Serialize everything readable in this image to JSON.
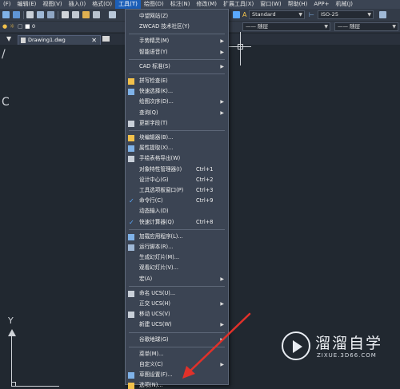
{
  "menubar": {
    "items": [
      "(F)",
      "编辑(E)",
      "视图(V)",
      "插入(I)",
      "格式(O)",
      "工具(T)",
      "绘图(D)",
      "标注(N)",
      "修改(M)",
      "扩展工具(X)",
      "窗口(W)",
      "帮助(H)",
      "APP+",
      "机械(J)"
    ],
    "active_index": 5
  },
  "toolbar": {
    "text_style": "Standard",
    "dim_style": "ISO-25",
    "layer_left": "0",
    "linetype": "—— 随层",
    "lineweight": "—— 随层"
  },
  "doc_tab": {
    "filename": "Drawing1.dwg",
    "close": "✕"
  },
  "canvas": {
    "ucs_y": "Y",
    "ucs_x": "X",
    "ghost_left": "/",
    "ghost_left2": "C"
  },
  "tools_menu": {
    "items": [
      {
        "label": "中望网站(Z)",
        "shortcut": "",
        "submenu": false,
        "icon": "",
        "checked": false
      },
      {
        "label": "ZWCAD 技术社区(Y)",
        "shortcut": "",
        "submenu": false,
        "icon": "",
        "checked": false
      },
      {
        "sep": true
      },
      {
        "label": "手势精灵(M)",
        "shortcut": "",
        "submenu": true,
        "icon": "",
        "checked": false
      },
      {
        "label": "智能语音(Y)",
        "shortcut": "",
        "submenu": true,
        "icon": "",
        "checked": false
      },
      {
        "sep": true
      },
      {
        "label": "CAD 标准(S)",
        "shortcut": "",
        "submenu": true,
        "icon": "",
        "checked": false
      },
      {
        "sep": true
      },
      {
        "label": "拼写检查(E)",
        "shortcut": "",
        "submenu": false,
        "icon": "spell-check-icon",
        "checked": false
      },
      {
        "label": "快速选择(K)...",
        "shortcut": "",
        "submenu": false,
        "icon": "quick-select-icon",
        "checked": false
      },
      {
        "label": "绘图次序(D)...",
        "shortcut": "",
        "submenu": true,
        "icon": "",
        "checked": false
      },
      {
        "label": "查询(Q)",
        "shortcut": "",
        "submenu": true,
        "icon": "",
        "checked": false
      },
      {
        "label": "更新字段(T)",
        "shortcut": "",
        "submenu": false,
        "icon": "update-field-icon",
        "checked": false
      },
      {
        "sep": true
      },
      {
        "label": "块编辑器(B)...",
        "shortcut": "",
        "submenu": false,
        "icon": "block-editor-icon",
        "checked": false
      },
      {
        "label": "属性提取(X)...",
        "shortcut": "",
        "submenu": false,
        "icon": "attribute-extract-icon",
        "checked": false
      },
      {
        "label": "手绘表格导出(W)",
        "shortcut": "",
        "submenu": false,
        "icon": "table-export-icon",
        "checked": false
      },
      {
        "label": "对象特性管理器(I)",
        "shortcut": "Ctrl+1",
        "submenu": false,
        "icon": "",
        "checked": false
      },
      {
        "label": "设计中心(G)",
        "shortcut": "Ctrl+2",
        "submenu": false,
        "icon": "",
        "checked": false
      },
      {
        "label": "工具选项板窗口(P)",
        "shortcut": "Ctrl+3",
        "submenu": false,
        "icon": "",
        "checked": false
      },
      {
        "label": "命令行(C)",
        "shortcut": "Ctrl+9",
        "submenu": false,
        "icon": "",
        "checked": true
      },
      {
        "label": "动态输入(D)",
        "shortcut": "",
        "submenu": false,
        "icon": "",
        "checked": false
      },
      {
        "label": "快速计算器(Q)",
        "shortcut": "Ctrl+8",
        "submenu": false,
        "icon": "",
        "checked": true
      },
      {
        "sep": true
      },
      {
        "label": "加载应用程序(L)...",
        "shortcut": "",
        "submenu": false,
        "icon": "load-app-icon",
        "checked": false
      },
      {
        "label": "运行脚本(R)...",
        "shortcut": "",
        "submenu": false,
        "icon": "run-script-icon",
        "checked": false
      },
      {
        "label": "生成幻灯片(M)...",
        "shortcut": "",
        "submenu": false,
        "icon": "",
        "checked": false
      },
      {
        "label": "观看幻灯片(V)...",
        "shortcut": "",
        "submenu": false,
        "icon": "",
        "checked": false
      },
      {
        "label": "宏(A)",
        "shortcut": "",
        "submenu": true,
        "icon": "",
        "checked": false
      },
      {
        "sep": true
      },
      {
        "label": "命名 UCS(U)...",
        "shortcut": "",
        "submenu": false,
        "icon": "named-ucs-icon",
        "checked": false
      },
      {
        "label": "正交 UCS(H)",
        "shortcut": "",
        "submenu": true,
        "icon": "",
        "checked": false
      },
      {
        "label": "移动 UCS(V)",
        "shortcut": "",
        "submenu": false,
        "icon": "move-ucs-icon",
        "checked": false
      },
      {
        "label": "新建 UCS(W)",
        "shortcut": "",
        "submenu": true,
        "icon": "",
        "checked": false
      },
      {
        "sep": true
      },
      {
        "label": "谷歌地球(G)",
        "shortcut": "",
        "submenu": true,
        "icon": "",
        "checked": false
      },
      {
        "sep": true
      },
      {
        "label": "菜单(M)...",
        "shortcut": "",
        "submenu": false,
        "icon": "",
        "checked": false
      },
      {
        "label": "自定义(C)",
        "shortcut": "",
        "submenu": true,
        "icon": "",
        "checked": false
      },
      {
        "label": "草图设置(F)...",
        "shortcut": "",
        "submenu": false,
        "icon": "drafting-settings-icon",
        "checked": false
      },
      {
        "label": "选项(N)...",
        "shortcut": "",
        "submenu": false,
        "icon": "options-gear-icon",
        "checked": false
      }
    ]
  },
  "watermark": {
    "title": "溜溜自学",
    "url": "ZIXUE.3D66.COM"
  },
  "colors": {
    "menubar": "#3b4453",
    "menu_active": "#1c5fb8",
    "canvas": "#212830",
    "arrow": "#e0312a",
    "check": "#5aa9ff"
  }
}
